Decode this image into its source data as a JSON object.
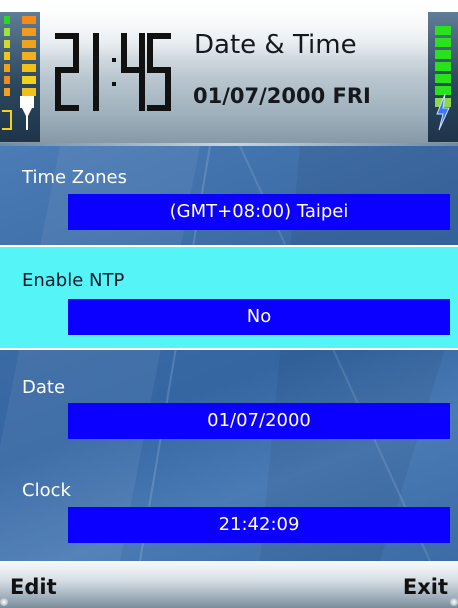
{
  "header": {
    "clock_time": "21:45",
    "title": "Date & Time",
    "date": "01/07/2000 FRI",
    "icons": [
      "signal-strength-icon",
      "antenna-icon",
      "battery-icon",
      "charging-bolt-icon"
    ],
    "signal_level_bars": 7,
    "battery_level_segments": 7
  },
  "settings": {
    "time_zones": {
      "label": "Time Zones",
      "value": "(GMT+08:00) Taipei"
    },
    "enable_ntp": {
      "label": "Enable NTP",
      "value": "No",
      "selected": true
    },
    "date": {
      "label": "Date",
      "value": "01/07/2000"
    },
    "clock": {
      "label": "Clock",
      "value": "21:42:09"
    }
  },
  "softkeys": {
    "left": "Edit",
    "right": "Exit"
  },
  "colors": {
    "value_box": "#0b00ff",
    "selected_row": "#55f4f6",
    "background": "#3f6ea8",
    "battery": "#29e21b",
    "signal_low": "#f3a11a",
    "signal_high": "#28d821"
  }
}
